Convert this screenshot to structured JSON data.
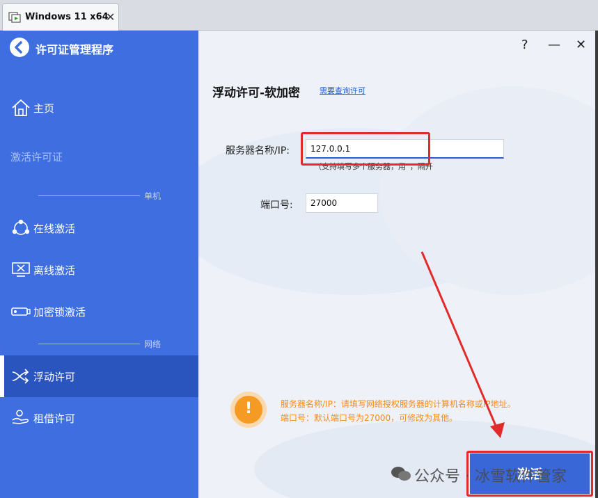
{
  "vm": {
    "tab_title": "Windows 11 x64",
    "tab_close": "✕"
  },
  "app": {
    "title": "许可证管理程序"
  },
  "window_controls": {
    "help": "?",
    "minimize": "—",
    "close": "✕"
  },
  "nav": {
    "home": "主页",
    "activate_license": "激活许可证",
    "section_standalone": "单机",
    "online_activation": "在线激活",
    "offline_activation": "离线激活",
    "dongle_activation": "加密锁激活",
    "section_network": "网络",
    "floating_license": "浮动许可",
    "borrow_license": "租借许可"
  },
  "page": {
    "title": "浮动许可-软加密",
    "help_link": "需要查询许可",
    "server_label": "服务器名称/IP:",
    "server_value": "127.0.0.1",
    "server_hint": "（支持填写多个服务器，用“，”隔开",
    "port_label": "端口号:",
    "port_value": "27000"
  },
  "info": {
    "icon": "!",
    "line1": "服务器名称/IP：请填写网络授权服务器的计算机名称或IP地址。",
    "line2": "端口号：默认端口号为27000，可修改为其他。"
  },
  "buttons": {
    "activate": "激活"
  },
  "watermark": {
    "text": "公众号 · 冰雪软件管家"
  },
  "colors": {
    "sidebar": "#3f6ee0",
    "active": "#2a55be",
    "accent": "#f59a23",
    "highlight": "#e12a2a"
  }
}
